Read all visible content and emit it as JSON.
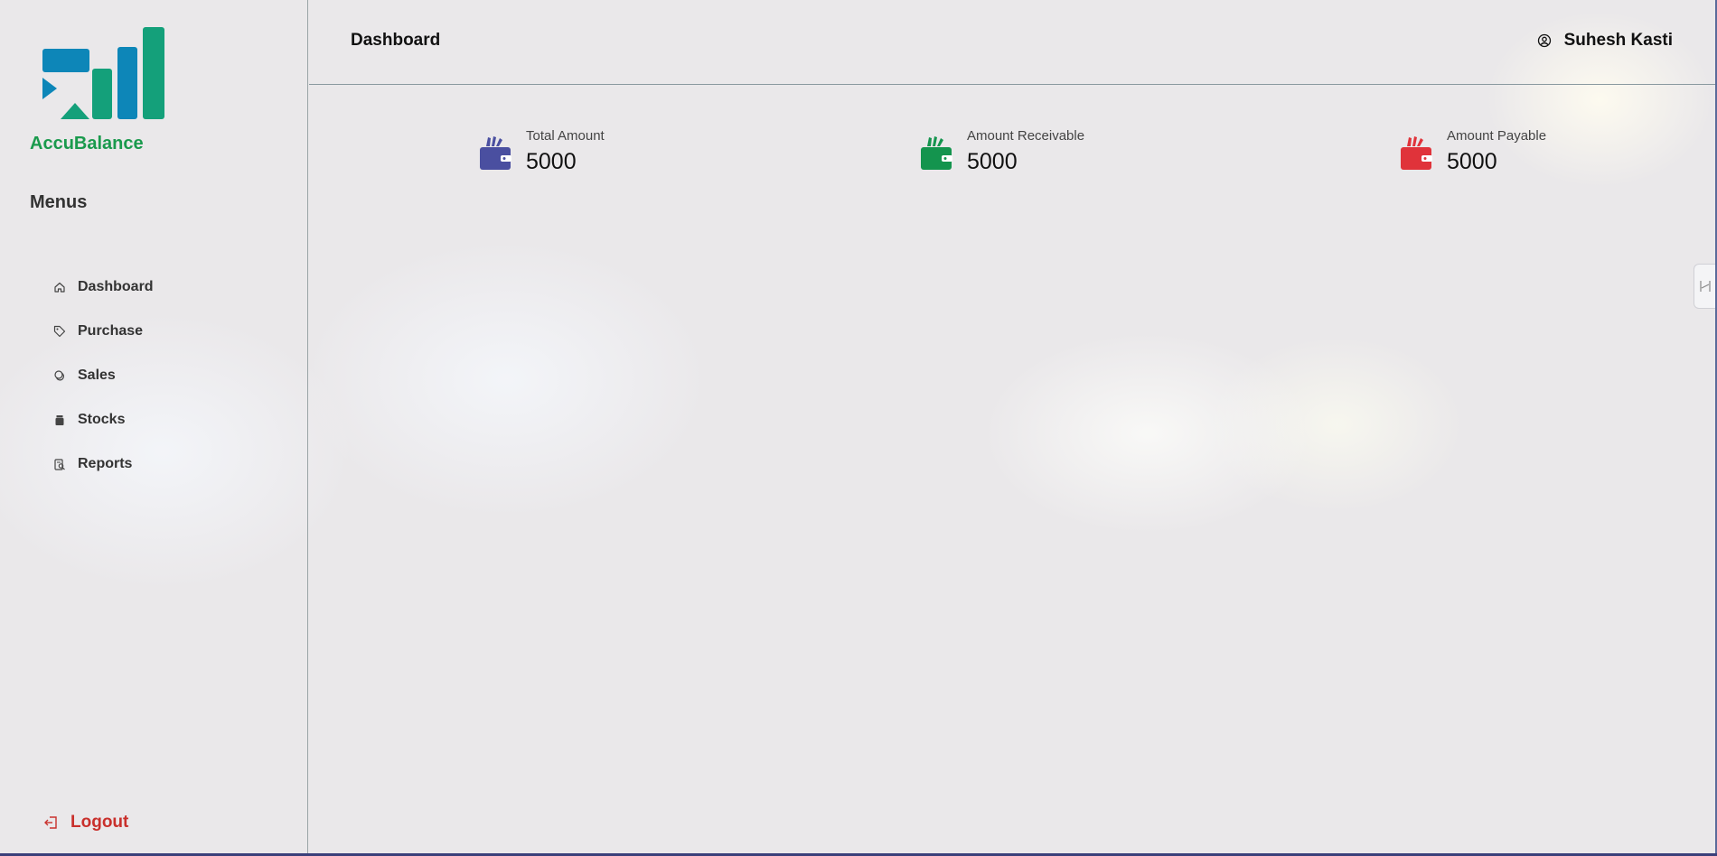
{
  "brand": {
    "name": "AccuBalance",
    "color": "#1a9a4d"
  },
  "sidebar": {
    "menus_title": "Menus",
    "items": [
      {
        "label": "Dashboard",
        "icon": "home-icon"
      },
      {
        "label": "Purchase",
        "icon": "tag-icon"
      },
      {
        "label": "Sales",
        "icon": "coins-icon"
      },
      {
        "label": "Stocks",
        "icon": "box-icon"
      },
      {
        "label": "Reports",
        "icon": "report-search-icon"
      }
    ],
    "logout_label": "Logout"
  },
  "header": {
    "title": "Dashboard",
    "user_name": "Suhesh Kasti"
  },
  "cards": [
    {
      "caption": "Total Amount",
      "value": "5000",
      "color": "#4a4fa0"
    },
    {
      "caption": "Amount Receivable",
      "value": "5000",
      "color": "#14944e"
    },
    {
      "caption": "Amount Payable",
      "value": "5000",
      "color": "#e0333a"
    }
  ]
}
